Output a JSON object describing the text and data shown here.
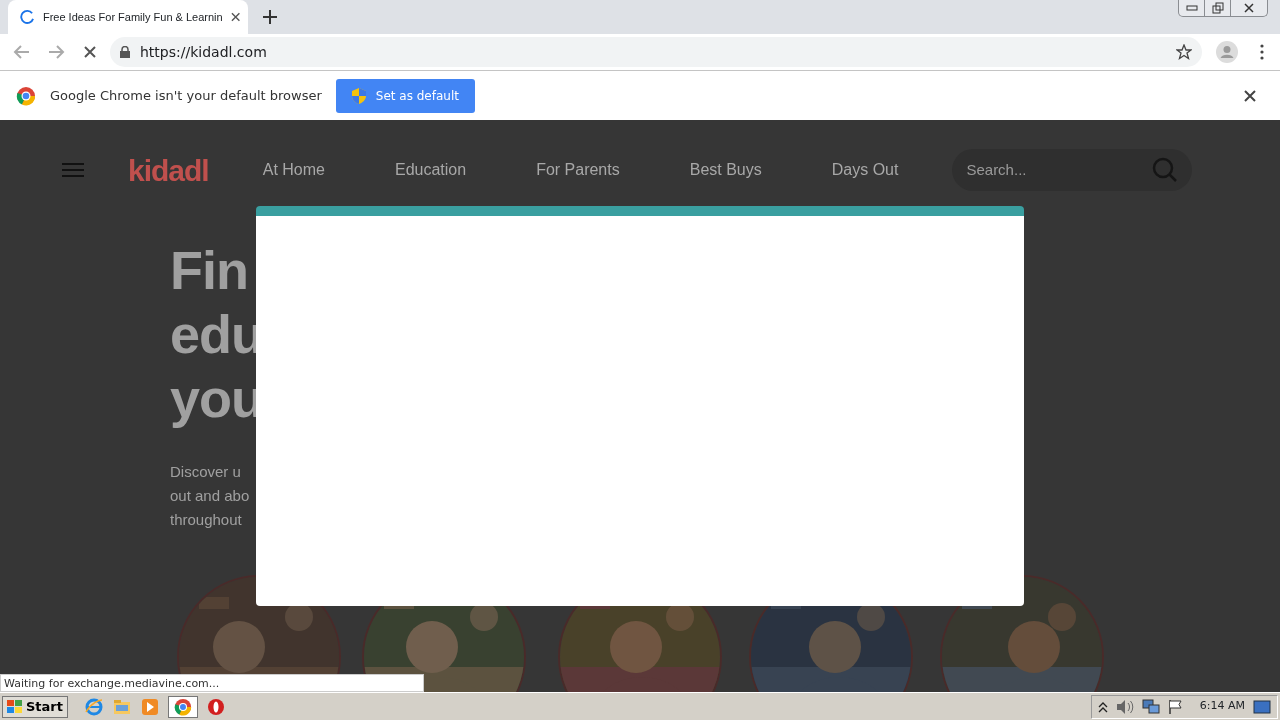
{
  "browser": {
    "tab_title": "Free Ideas For Family Fun & Learnin",
    "url": "https://kidadl.com"
  },
  "infobar": {
    "message": "Google Chrome isn't your default browser",
    "button": "Set as default"
  },
  "site": {
    "logo": "kidadl",
    "nav": [
      "At Home",
      "Education",
      "For Parents",
      "Best Buys",
      "Days Out"
    ],
    "search": {
      "placeholder": "Search..."
    },
    "hero_title": [
      "Fin",
      "edu",
      "you"
    ],
    "hero_text": [
      "Discover u",
      "out and abo",
      "throughout"
    ]
  },
  "status_text": "Waiting for exchange.mediavine.com...",
  "taskbar": {
    "start": "Start",
    "clock": "6:14 AM"
  }
}
